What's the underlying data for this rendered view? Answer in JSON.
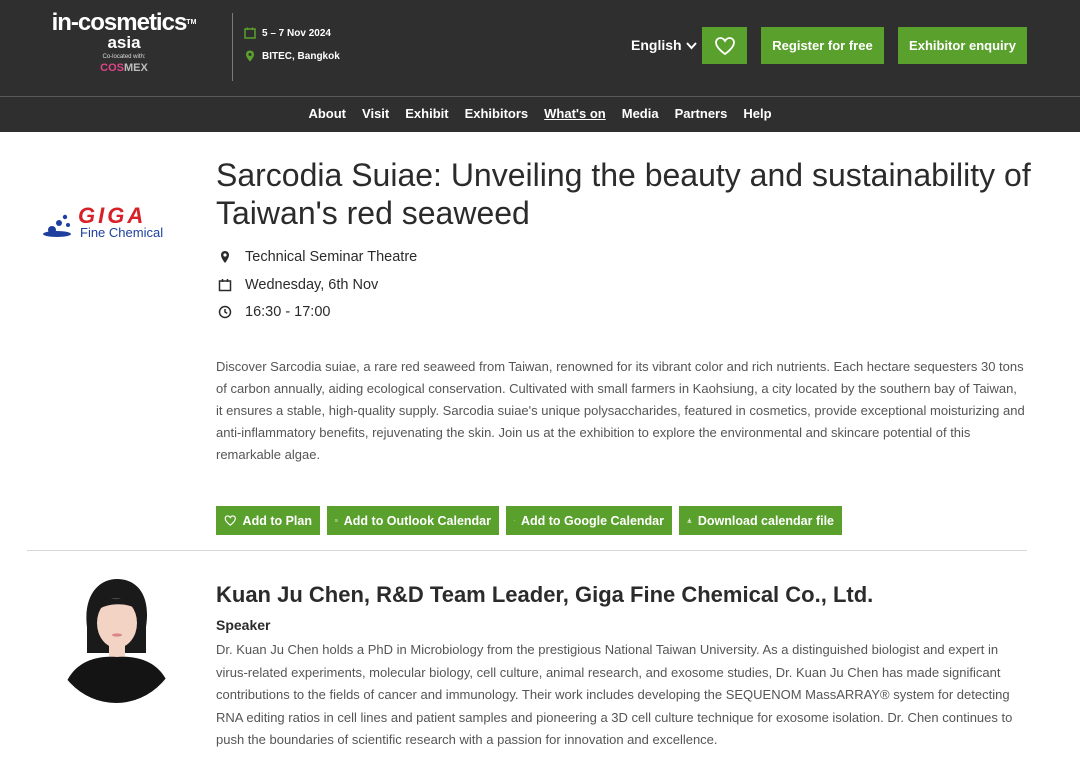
{
  "header": {
    "logo": {
      "main": "in-cosmetics",
      "tm": "TM",
      "sub": "asia",
      "colocated": "Co-located with:",
      "cosmex_a": "COS",
      "cosmex_b": "MEX"
    },
    "event_dates": "5 – 7 Nov 2024",
    "event_venue": "BITEC, Bangkok",
    "language": "English",
    "register_label": "Register for free",
    "enquiry_label": "Exhibitor enquiry",
    "accent_color": "#5aa02c"
  },
  "nav": {
    "items": [
      "About",
      "Visit",
      "Exhibit",
      "Exhibitors",
      "What's on",
      "Media",
      "Partners",
      "Help"
    ],
    "active": "What's on"
  },
  "sponsor": {
    "logo_text": "GIGA",
    "logo_sub": "Fine Chemical"
  },
  "session": {
    "title": "Sarcodia Suiae: Unveiling the beauty and sustainability of Taiwan's red seaweed",
    "location": "Technical Seminar Theatre",
    "date": "Wednesday, 6th Nov",
    "time": "16:30 - 17:00",
    "description": "Discover Sarcodia suiae, a rare red seaweed from Taiwan, renowned for its vibrant color and rich nutrients. Each hectare sequesters 30 tons of carbon annually, aiding ecological conservation. Cultivated with small farmers in Kaohsiung, a city located by the southern bay of Taiwan, it ensures a stable, high-quality supply. Sarcodia suiae's unique polysaccharides, featured in cosmetics, provide exceptional moisturizing and anti-inflammatory benefits, rejuvenating the skin. Join us at the exhibition to explore the environmental and skincare potential of this remarkable algae."
  },
  "actions": {
    "add_to_plan": "Add to Plan",
    "outlook": "Add to Outlook Calendar",
    "google": "Add to Google Calendar",
    "download": "Download calendar file"
  },
  "speaker": {
    "name": "Kuan Ju Chen, R&D Team Leader, Giga Fine Chemical Co., Ltd.",
    "role": "Speaker",
    "bio": "Dr. Kuan Ju Chen holds a PhD in Microbiology from the prestigious National Taiwan University. As a distinguished biologist and expert in virus-related experiments, molecular biology, cell culture, animal research, and exosome studies, Dr. Kuan Ju Chen has made significant contributions to the fields of cancer and immunology. Their work includes developing the SEQUENOM MassARRAY® system for detecting RNA editing ratios in cell lines and patient samples and pioneering a 3D cell culture technique for exosome isolation. Dr. Chen continues to push the boundaries of scientific research with a passion for innovation and excellence."
  }
}
